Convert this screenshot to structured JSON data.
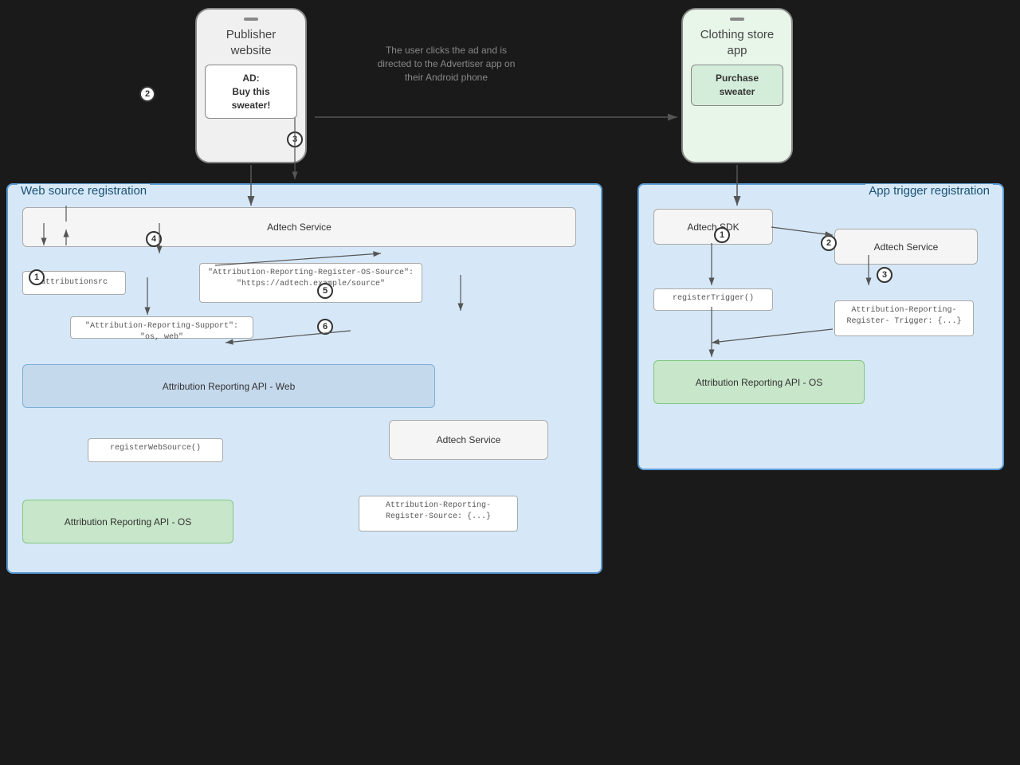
{
  "publisher_phone": {
    "title": "Publisher\nwebsite",
    "ad_label": "AD:",
    "ad_text": "Buy this\nsweater!"
  },
  "clothing_phone": {
    "title": "Clothing store\napp",
    "button_text": "Purchase\nsweater"
  },
  "desc_arrow": "The user clicks the ad and is\ndirected to the Advertiser app on\ntheir Android phone",
  "web_box": {
    "title": "Web source registration",
    "adtech_service_top": "Adtech Service",
    "attributionsrc": "attributionsrc",
    "header_code": "\"Attribution-Reporting-Register-OS-Source\":\n\"https://adtech.example/source\"",
    "support_header": "\"Attribution-Reporting-Support\": \"os, web\"",
    "api_web": "Attribution Reporting API - Web",
    "num4": "④",
    "registerWebSource": "registerWebSource()",
    "adtech_service_bottom": "Adtech Service",
    "num5": "⑤",
    "num6": "⑥",
    "register_source_code": "Attribution-Reporting-\nRegister-Source: {...}",
    "api_os": "Attribution Reporting API - OS"
  },
  "app_box": {
    "title": "App trigger registration",
    "adtech_sdk": "Adtech SDK",
    "num1": "①",
    "registerTrigger": "registerTrigger()",
    "num2": "②",
    "adtech_service": "Adtech Service",
    "num3": "③",
    "register_trigger_code": "Attribution-Reporting-Register-\nTrigger: {...}",
    "api_os": "Attribution Reporting API - OS"
  }
}
